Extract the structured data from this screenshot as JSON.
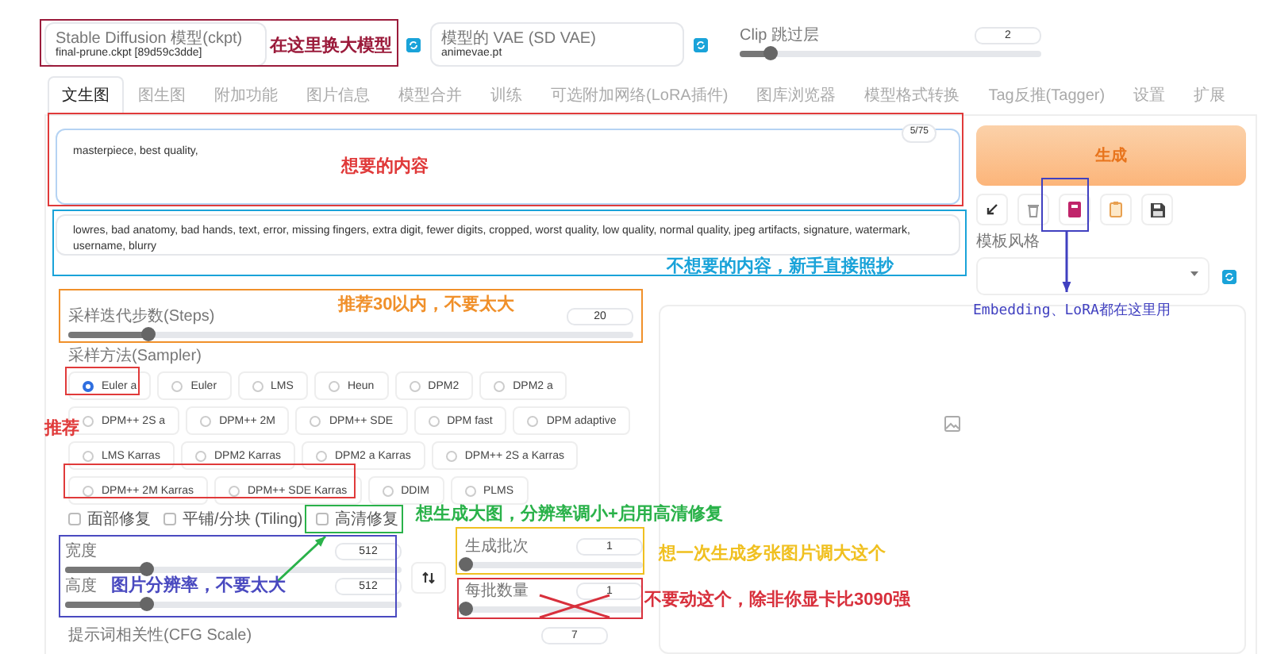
{
  "top": {
    "model": {
      "label": "Stable Diffusion 模型(ckpt)",
      "value": "final-prune.ckpt [89d59c3dde]"
    },
    "vae": {
      "label": "模型的 VAE (SD VAE)",
      "value": "animevae.pt"
    },
    "clip_skip": {
      "label": "Clip 跳过层",
      "value": "2",
      "level": 0.1
    }
  },
  "tabs": [
    {
      "label": "文生图",
      "selected": true
    },
    {
      "label": "图生图",
      "selected": false
    },
    {
      "label": "附加功能",
      "selected": false
    },
    {
      "label": "图片信息",
      "selected": false
    },
    {
      "label": "模型合并",
      "selected": false
    },
    {
      "label": "训练",
      "selected": false
    },
    {
      "label": "可选附加网络(LoRA插件)",
      "selected": false
    },
    {
      "label": "图库浏览器",
      "selected": false
    },
    {
      "label": "模型格式转换",
      "selected": false
    },
    {
      "label": "Tag反推(Tagger)",
      "selected": false
    },
    {
      "label": "设置",
      "selected": false
    },
    {
      "label": "扩展",
      "selected": false
    }
  ],
  "prompt": {
    "value": "masterpiece, best quality,",
    "counter": "5/75"
  },
  "negative_prompt": {
    "value": "lowres, bad anatomy, bad hands, text, error, missing fingers, extra digit, fewer digits, cropped, worst quality, low quality, normal quality, jpeg artifacts, signature, watermark, username, blurry"
  },
  "generate": {
    "label": "生成"
  },
  "style": {
    "label": "模板风格"
  },
  "steps": {
    "label": "采样迭代步数(Steps)",
    "value": "20",
    "level": 0.14
  },
  "sampler": {
    "label": "采样方法(Sampler)",
    "options": [
      {
        "label": "Euler a",
        "selected": true
      },
      {
        "label": "Euler",
        "selected": false
      },
      {
        "label": "LMS",
        "selected": false
      },
      {
        "label": "Heun",
        "selected": false
      },
      {
        "label": "DPM2",
        "selected": false
      },
      {
        "label": "DPM2 a",
        "selected": false
      },
      {
        "label": "DPM++ 2S a",
        "selected": false
      },
      {
        "label": "DPM++ 2M",
        "selected": false
      },
      {
        "label": "DPM++ SDE",
        "selected": false
      },
      {
        "label": "DPM fast",
        "selected": false
      },
      {
        "label": "DPM adaptive",
        "selected": false
      },
      {
        "label": "LMS Karras",
        "selected": false
      },
      {
        "label": "DPM2 Karras",
        "selected": false
      },
      {
        "label": "DPM2 a Karras",
        "selected": false
      },
      {
        "label": "DPM++ 2S a Karras",
        "selected": false
      },
      {
        "label": "DPM++ 2M Karras",
        "selected": false
      },
      {
        "label": "DPM++ SDE Karras",
        "selected": false
      },
      {
        "label": "DDIM",
        "selected": false
      },
      {
        "label": "PLMS",
        "selected": false
      }
    ]
  },
  "options": [
    {
      "label": "面部修复",
      "checked": false
    },
    {
      "label": "平铺/分块 (Tiling)",
      "checked": false
    },
    {
      "label": "高清修复",
      "checked": false
    }
  ],
  "width": {
    "label": "宽度",
    "value": "512",
    "level": 0.24
  },
  "height": {
    "label": "高度",
    "value": "512",
    "level": 0.24
  },
  "batch_count": {
    "label": "生成批次",
    "value": "1",
    "level": 0
  },
  "batch_size": {
    "label": "每批数量",
    "value": "1",
    "level": 0
  },
  "cfg": {
    "label": "提示词相关性(CFG Scale)",
    "value": "7"
  },
  "annotations": [
    {
      "text": "在这里换大模型",
      "color": "#9b1b3b",
      "kind": "plain"
    },
    {
      "text": "想要的内容",
      "color": "#e03a3a",
      "kind": "plain"
    },
    {
      "text": "不想要的内容，新手直接照抄",
      "color": "#1aa3d9",
      "kind": "plain"
    },
    {
      "text": "推荐30以内，不要太大",
      "color": "#f0902a",
      "kind": "plain"
    },
    {
      "text": "Embedding、LoRA都在这里用",
      "color": "#4040c0",
      "kind": "arrow"
    },
    {
      "text": "推荐",
      "color": "#e03a3a",
      "kind": "plain"
    },
    {
      "text": "想生成大图，分辨率调小+启用高清修复",
      "color": "#2ab24a",
      "kind": "arrow"
    },
    {
      "text": "图片分辨率，不要太大",
      "color": "#4a4ac0",
      "kind": "plain"
    },
    {
      "text": "想一次生成多张图片调大这个",
      "color": "#f0c020",
      "kind": "plain"
    },
    {
      "text": "不要动这个，除非你显卡比3090强",
      "color": "#d8303c",
      "kind": "crossed"
    }
  ]
}
